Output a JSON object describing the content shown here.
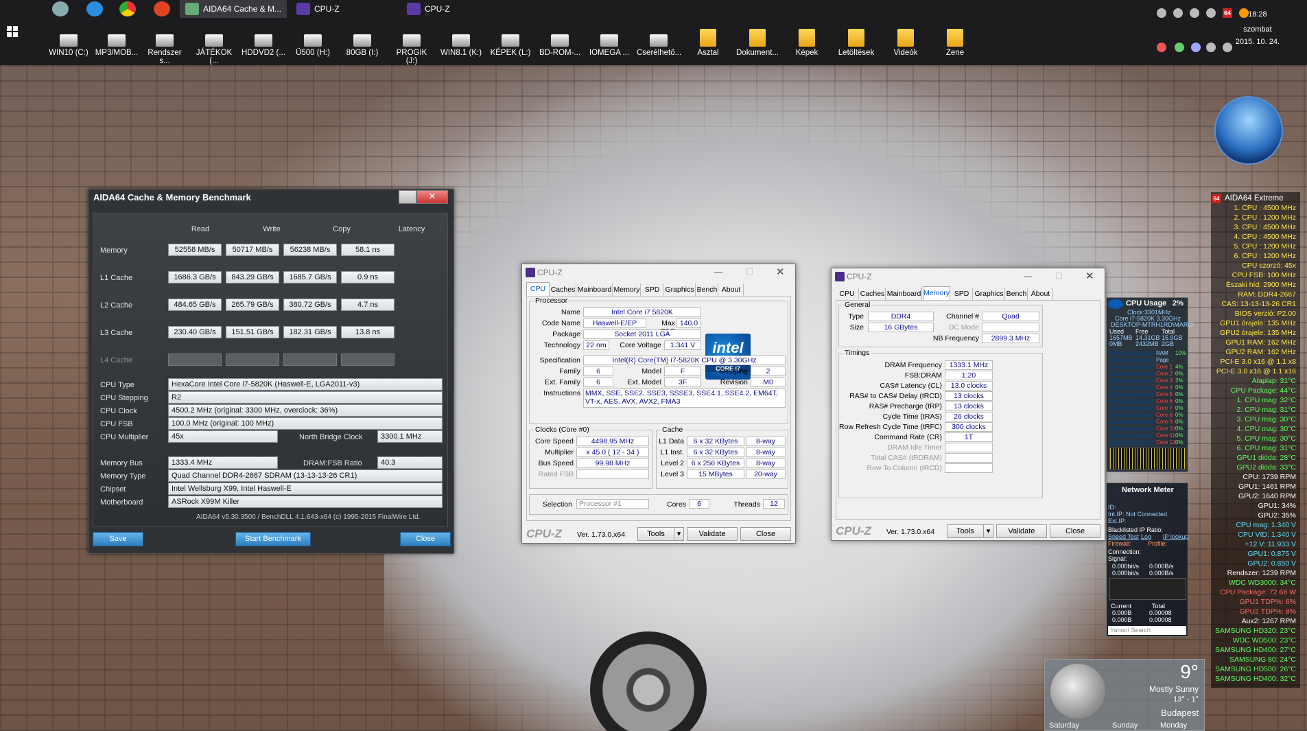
{
  "taskbar": {
    "tasks": [
      {
        "label": "AIDA64 Cache & M..."
      },
      {
        "label": "CPU-Z"
      },
      {
        "label": "CPU-Z"
      }
    ],
    "drives": [
      "WIN10 (C:)",
      "MP3/MOB...",
      "Rendszer s...",
      "JÁTÉKOK (...",
      "HDDVD2 (...",
      "Ü500 (H:)",
      "80GB (I:)",
      "PROGIK (J:)",
      "WIN8.1 (K:)",
      "KÉPEK (L:)",
      "BD-ROM-...",
      "IOMEGA ...",
      "Cserélhető..."
    ],
    "folders": [
      "Asztal",
      "Dokument...",
      "Képek",
      "Letöltések",
      "Videók",
      "Zene"
    ],
    "clock": {
      "time": "18:28",
      "day": "szombat",
      "date": "2015. 10. 24."
    },
    "tray_badge": "64"
  },
  "aida": {
    "title": "AIDA64 Cache & Memory Benchmark",
    "headers": [
      "Read",
      "Write",
      "Copy",
      "Latency"
    ],
    "rows": [
      {
        "label": "Memory",
        "read": "52558 MB/s",
        "write": "50717 MB/s",
        "copy": "56238 MB/s",
        "latency": "58.1 ns"
      },
      {
        "label": "L1 Cache",
        "read": "1686.3 GB/s",
        "write": "843.29 GB/s",
        "copy": "1685.7 GB/s",
        "latency": "0.9 ns"
      },
      {
        "label": "L2 Cache",
        "read": "484.65 GB/s",
        "write": "265.79 GB/s",
        "copy": "380.72 GB/s",
        "latency": "4.7 ns"
      },
      {
        "label": "L3 Cache",
        "read": "230.40 GB/s",
        "write": "151.51 GB/s",
        "copy": "182.31 GB/s",
        "latency": "13.8 ns"
      },
      {
        "label": "L4 Cache",
        "read": "",
        "write": "",
        "copy": "",
        "latency": ""
      }
    ],
    "info": {
      "cpu_type_label": "CPU Type",
      "cpu_type": "HexaCore Intel Core i7-5820K  (Haswell-E, LGA2011-v3)",
      "cpu_stepping_label": "CPU Stepping",
      "cpu_stepping": "R2",
      "cpu_clock_label": "CPU Clock",
      "cpu_clock": "4500.2 MHz  (original: 3300 MHz, overclock: 36%)",
      "cpu_fsb_label": "CPU FSB",
      "cpu_fsb": "100.0 MHz  (original: 100 MHz)",
      "cpu_mult_label": "CPU Multiplier",
      "cpu_mult": "45x",
      "nb_clock_label": "North Bridge Clock",
      "nb_clock": "3300.1 MHz",
      "mem_bus_label": "Memory Bus",
      "mem_bus": "1333.4 MHz",
      "dram_fsb_label": "DRAM:FSB Ratio",
      "dram_fsb": "40:3",
      "mem_type_label": "Memory Type",
      "mem_type": "Quad Channel DDR4-2667 SDRAM  (13-13-13-26 CR1)",
      "chipset_label": "Chipset",
      "chipset": "Intel Wellsburg X99, Intel Haswell-E",
      "mobo_label": "Motherboard",
      "mobo": "ASRock X99M Killer"
    },
    "copyright": "AIDA64 v5.30.3500 / BenchDLL 4.1.643-x64  (c) 1995-2015 FinalWire Ltd.",
    "buttons": {
      "save": "Save",
      "start": "Start Benchmark",
      "close": "Close"
    }
  },
  "cpuz1": {
    "title": "CPU-Z",
    "tabs": [
      "CPU",
      "Caches",
      "Mainboard",
      "Memory",
      "SPD",
      "Graphics",
      "Bench",
      "About"
    ],
    "processor": {
      "group": "Processor",
      "name_l": "Name",
      "name": "Intel Core i7 5820K",
      "code_l": "Code Name",
      "code": "Haswell-E/EP",
      "tdp_l": "Max TDP",
      "tdp": "140.0 W",
      "package_l": "Package",
      "package": "Socket 2011 LGA",
      "tech_l": "Technology",
      "tech": "22 nm",
      "volt_l": "Core Voltage",
      "volt": "1.341 V",
      "spec_l": "Specification",
      "spec": "Intel(R) Core(TM) i7-5820K CPU @ 3.30GHz",
      "family_l": "Family",
      "family": "6",
      "model_l": "Model",
      "model": "F",
      "stepping_l": "Stepping",
      "stepping": "2",
      "extfam_l": "Ext. Family",
      "extfam": "6",
      "extmod_l": "Ext. Model",
      "extmod": "3F",
      "rev_l": "Revision",
      "rev": "M0",
      "instr_l": "Instructions",
      "instr": "MMX, SSE, SSE2, SSE3, SSSE3, SSE4.1, SSE4.2, EM64T, VT-x, AES, AVX, AVX2, FMA3",
      "intel_logo": "intel",
      "intel_inside": "inside",
      "intel_core": "CORE i7"
    },
    "clocks": {
      "group": "Clocks (Core #0)",
      "speed_l": "Core Speed",
      "speed": "4498.95 MHz",
      "mult_l": "Multiplier",
      "mult": "x 45.0 ( 12 - 34 )",
      "bus_l": "Bus Speed",
      "bus": "99.98 MHz",
      "rated_l": "Rated FSB",
      "rated": ""
    },
    "cache": {
      "group": "Cache",
      "l1d_l": "L1 Data",
      "l1d": "6 x 32 KBytes",
      "l1d_w": "8-way",
      "l1i_l": "L1 Inst.",
      "l1i": "6 x 32 KBytes",
      "l1i_w": "8-way",
      "l2_l": "Level 2",
      "l2": "6 x 256 KBytes",
      "l2_w": "8-way",
      "l3_l": "Level 3",
      "l3": "15 MBytes",
      "l3_w": "20-way"
    },
    "selection_l": "Selection",
    "selection": "Processor #1",
    "cores_l": "Cores",
    "cores": "6",
    "threads_l": "Threads",
    "threads": "12",
    "footer": {
      "logo": "CPU-Z",
      "ver": "Ver. 1.73.0.x64",
      "tools": "Tools",
      "validate": "Validate",
      "close": "Close"
    }
  },
  "cpuz2": {
    "title": "CPU-Z",
    "tabs": [
      "CPU",
      "Caches",
      "Mainboard",
      "Memory",
      "SPD",
      "Graphics",
      "Bench",
      "About"
    ],
    "general": {
      "group": "General",
      "type_l": "Type",
      "type": "DDR4",
      "chan_l": "Channel #",
      "chan": "Quad",
      "size_l": "Size",
      "size": "16 GBytes",
      "dc_l": "DC Mode",
      "dc": "",
      "nb_l": "NB Frequency",
      "nb": "2899.3 MHz"
    },
    "timings": {
      "group": "Timings",
      "rows": [
        {
          "l": "DRAM Frequency",
          "v": "1333.1 MHz"
        },
        {
          "l": "FSB:DRAM",
          "v": "1:20"
        },
        {
          "l": "CAS# Latency (CL)",
          "v": "13.0 clocks"
        },
        {
          "l": "RAS# to CAS# Delay (tRCD)",
          "v": "13 clocks"
        },
        {
          "l": "RAS# Precharge (tRP)",
          "v": "13 clocks"
        },
        {
          "l": "Cycle Time (tRAS)",
          "v": "26 clocks"
        },
        {
          "l": "Row Refresh Cycle Time (tRFC)",
          "v": "300 clocks"
        },
        {
          "l": "Command Rate (CR)",
          "v": "1T"
        },
        {
          "l": "DRAM Idle Timer",
          "v": ""
        },
        {
          "l": "Total CAS# (tRDRAM)",
          "v": ""
        },
        {
          "l": "Row To Column (tRCD)",
          "v": ""
        }
      ]
    },
    "footer": {
      "logo": "CPU-Z",
      "ver": "Ver. 1.73.0.x64",
      "tools": "Tools",
      "validate": "Validate",
      "close": "Close"
    }
  },
  "sidebar": {
    "title": "AIDA64 Extreme",
    "badge": "64",
    "rows": [
      {
        "t": "1. CPU : 4500 MHz",
        "c": "#ffe94a"
      },
      {
        "t": "2. CPU : 1200 MHz",
        "c": "#ffe94a"
      },
      {
        "t": "3. CPU : 4500 MHz",
        "c": "#ffe94a"
      },
      {
        "t": "4. CPU : 4500 MHz",
        "c": "#ffe94a"
      },
      {
        "t": "5. CPU : 1200 MHz",
        "c": "#ffe94a"
      },
      {
        "t": "6. CPU : 1200 MHz",
        "c": "#ffe94a"
      },
      {
        "t": "CPU szorzó: 45x",
        "c": "#ffe94a"
      },
      {
        "t": "CPU FSB: 100 MHz",
        "c": "#ffe94a"
      },
      {
        "t": "Északi híd: 2900 MHz",
        "c": "#ffe94a"
      },
      {
        "t": "RAM: DDR4-2667",
        "c": "#ffe94a"
      },
      {
        "t": "CAS: 13-13-13-26 CR1",
        "c": "#ffe94a"
      },
      {
        "t": "BIOS verzió: P2.00",
        "c": "#ffe94a"
      },
      {
        "t": "GPU1 órajele: 135 MHz",
        "c": "#ffe94a"
      },
      {
        "t": "GPU2 órajele: 135 MHz",
        "c": "#ffe94a"
      },
      {
        "t": "GPU1 RAM: 162 MHz",
        "c": "#ffe94a"
      },
      {
        "t": "GPU2 RAM: 162 MHz",
        "c": "#ffe94a"
      },
      {
        "t": "PCI-E 3.0 x16 @ 1.1 x8",
        "c": "#ffe94a"
      },
      {
        "t": "PCI-E 3.0 x16 @ 1.1 x16",
        "c": "#ffe94a"
      },
      {
        "t": "Alaplap: 31°C",
        "c": "#5cff5c"
      },
      {
        "t": "CPU Package: 44°C",
        "c": "#5cff5c"
      },
      {
        "t": "1. CPU mag: 32°C",
        "c": "#5cff5c"
      },
      {
        "t": "2. CPU mag: 31°C",
        "c": "#5cff5c"
      },
      {
        "t": "3. CPU mag: 30°C",
        "c": "#5cff5c"
      },
      {
        "t": "4. CPU mag: 30°C",
        "c": "#5cff5c"
      },
      {
        "t": "5. CPU mag: 30°C",
        "c": "#5cff5c"
      },
      {
        "t": "6. CPU mag: 31°C",
        "c": "#5cff5c"
      },
      {
        "t": "GPU1 dióda: 28°C",
        "c": "#5cff5c"
      },
      {
        "t": "GPU2 dióda: 33°C",
        "c": "#5cff5c"
      },
      {
        "t": "CPU: 1739 RPM",
        "c": "#ffffff"
      },
      {
        "t": "GPU1: 1461 RPM",
        "c": "#ffffff"
      },
      {
        "t": "GPU2: 1640 RPM",
        "c": "#ffffff"
      },
      {
        "t": "GPU1: 34%",
        "c": "#ffffff"
      },
      {
        "t": "GPU2: 35%",
        "c": "#ffffff"
      },
      {
        "t": "CPU mag: 1.340 V",
        "c": "#5ce1ff"
      },
      {
        "t": "CPU VID: 1.340 V",
        "c": "#5ce1ff"
      },
      {
        "t": "+12 V: 11.933 V",
        "c": "#5ce1ff"
      },
      {
        "t": "GPU1: 0.875 V",
        "c": "#5ce1ff"
      },
      {
        "t": "GPU2: 0.850 V",
        "c": "#5ce1ff"
      },
      {
        "t": "Rendszer: 1239 RPM",
        "c": "#ffffff"
      },
      {
        "t": "WDC WD3000: 34°C",
        "c": "#5cff5c"
      },
      {
        "t": "CPU Package: 72.68 W",
        "c": "#ff6a6a"
      },
      {
        "t": "GPU1 TDP%: 6%",
        "c": "#ff6a6a"
      },
      {
        "t": "GPU2 TDP%: 8%",
        "c": "#ff6a6a"
      },
      {
        "t": "Aux2: 1267 RPM",
        "c": "#ffffff"
      },
      {
        "t": "SAMSUNG HD320: 23°C",
        "c": "#5cff5c"
      },
      {
        "t": "WDC WD500: 23°C",
        "c": "#5cff5c"
      },
      {
        "t": "SAMSUNG HD400: 27°C",
        "c": "#5cff5c"
      },
      {
        "t": "SAMSUNG 80: 24°C",
        "c": "#5cff5c"
      },
      {
        "t": "SAMSUNG HD500: 26°C",
        "c": "#5cff5c"
      },
      {
        "t": "SAMSUNG HD400: 32°C",
        "c": "#5cff5c"
      }
    ]
  },
  "cpu_gadget": {
    "title": "CPU Usage",
    "pct": "2%",
    "clock": "Clock:3301MHz",
    "model": "Core i7-5820K 3.30GHz",
    "host": "DESKTOP-MTRH1RD\\MARCI",
    "cols": [
      "Used",
      "Free",
      "Total"
    ],
    "ram": [
      "1657MB",
      "14.31GB",
      "15.9GB"
    ],
    "page": [
      "0MB",
      "2432MB",
      "2GB"
    ],
    "cores": [
      "RAM",
      "Page",
      "Core 1",
      "Core 2",
      "Core 3",
      "Core 4",
      "Core 5",
      "Core 6",
      "Core 7",
      "Core 8",
      "Core 9",
      "Core 10",
      "Core 11",
      "Core 12"
    ],
    "core_pct": [
      "10%",
      "",
      "4%",
      "0%",
      "2%",
      "0%",
      "0%",
      "0%",
      "0%",
      "0%",
      "0%",
      "0%",
      "0%",
      "0%"
    ]
  },
  "net_gadget": {
    "title": "Network Meter",
    "id": "ID:",
    "intip": "Int.IP: Not Connected",
    "extip": "Ext.IP:",
    "bl": "Blacklisted IP Ratio:",
    "speed": "Speed Test",
    "log": "Log",
    "lookup": "IP lookup",
    "firewall": "Firewall:",
    "profile": "Profile:",
    "conn": "Connection:",
    "signal": "Signal:",
    "up": "0.000bit/s",
    "down": "0.000bit/s",
    "upb": "0.000B/s",
    "downb": "0.000B/s",
    "current": "Current",
    "total": "Total",
    "cur1": "0.000B",
    "cur2": "0.000B",
    "tot1": "0.00008",
    "tot2": "0.00008",
    "search": "Yahoo! Search"
  },
  "weather": {
    "temp": "9°",
    "cond": "Mostly Sunny",
    "range": "13° - 1°",
    "city": "Budapest",
    "days": [
      "Saturday",
      "Sunday",
      "Monday"
    ]
  }
}
